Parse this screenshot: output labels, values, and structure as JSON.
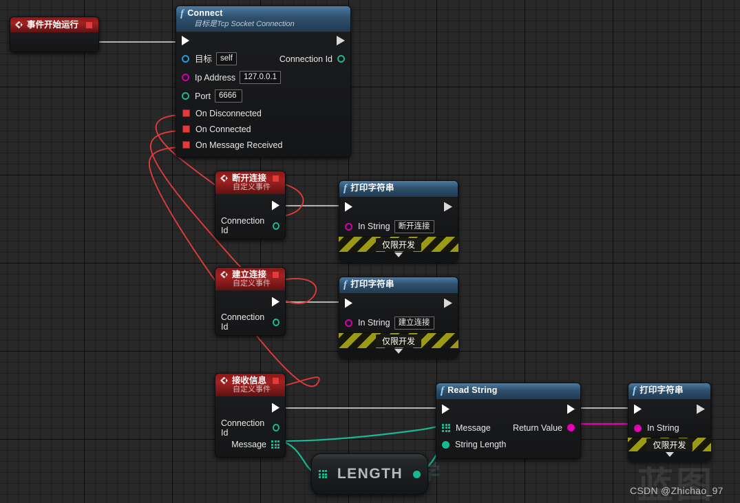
{
  "graph": {
    "background_color": "#282828",
    "grid_line_color": "#1c1c1c"
  },
  "nodes": {
    "event_begin_play": {
      "title": "事件开始运行",
      "exec_out_name": "exec-out"
    },
    "connect": {
      "title": "Connect",
      "subtitle": "目标是Tcp Socket Connection",
      "inputs": [
        {
          "label": "目标",
          "value": "self",
          "pin": "object"
        },
        {
          "label": "Ip Address",
          "value": "127.0.0.1",
          "pin": "string"
        },
        {
          "label": "Port",
          "value": "6666",
          "pin": "int"
        }
      ],
      "outputs": [
        {
          "label": "Connection Id",
          "pin": "int"
        }
      ],
      "delegates": [
        {
          "label": "On Disconnected"
        },
        {
          "label": "On Connected"
        },
        {
          "label": "On Message Received"
        }
      ]
    },
    "event_disconnect": {
      "title": "断开连接",
      "subtitle": "自定义事件",
      "outputs": [
        {
          "label": "Connection Id"
        }
      ]
    },
    "event_connect": {
      "title": "建立连接",
      "subtitle": "自定义事件",
      "outputs": [
        {
          "label": "Connection Id"
        }
      ]
    },
    "event_receive": {
      "title": "接收信息",
      "subtitle": "自定义事件",
      "outputs": [
        {
          "label": "Connection Id"
        },
        {
          "label": "Message"
        }
      ]
    },
    "print_disconnect": {
      "title": "打印字符串",
      "in_string_label": "In String",
      "in_string_value": "断开连接",
      "dev_only": "仅限开发"
    },
    "print_connect": {
      "title": "打印字符串",
      "in_string_label": "In String",
      "in_string_value": "建立连接",
      "dev_only": "仅限开发"
    },
    "read_string": {
      "title": "Read String",
      "inputs": [
        {
          "label": "Message"
        },
        {
          "label": "String Length"
        }
      ],
      "outputs": [
        {
          "label": "Return Value"
        }
      ]
    },
    "print_message": {
      "title": "打印字符串",
      "in_string_label": "In String",
      "dev_only": "仅限开发"
    },
    "length": {
      "title": "LENGTH"
    }
  },
  "watermarks": {
    "big": "蓝图",
    "mid": "蓝图教学",
    "credit": "CSDN @Zhichao_97"
  },
  "colors": {
    "exec_wire": "#b4b4b4",
    "delegate_wire": "#e03b3b",
    "string_wire": "#e600b3",
    "int_wire": "#19b893",
    "header_function": "#2e4f6b",
    "header_event": "#a32222"
  }
}
